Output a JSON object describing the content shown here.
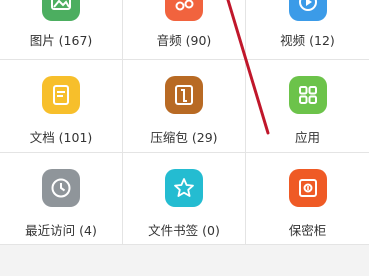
{
  "colors": {
    "pictures": "#4cae60",
    "audio": "#f1633e",
    "video": "#3b9be8",
    "documents": "#f7bf2b",
    "archives": "#b86a24",
    "apps": "#6cc34a",
    "recent": "#8f959a",
    "bookmarks": "#24bcd1",
    "safe": "#ef5a25",
    "annotation_arrow": "#c0172b"
  },
  "categories": [
    {
      "label": "图片 (167)",
      "icon": "picture-icon"
    },
    {
      "label": "音频 (90)",
      "icon": "music-icon"
    },
    {
      "label": "视频 (12)",
      "icon": "video-icon"
    },
    {
      "label": "文档 (101)",
      "icon": "document-icon"
    },
    {
      "label": "压缩包 (29)",
      "icon": "archive-icon"
    },
    {
      "label": "应用",
      "icon": "apps-grid-icon"
    },
    {
      "label": "最近访问 (4)",
      "icon": "clock-icon"
    },
    {
      "label": "文件书签 (0)",
      "icon": "star-icon"
    },
    {
      "label": "保密柜",
      "icon": "safe-icon"
    }
  ]
}
